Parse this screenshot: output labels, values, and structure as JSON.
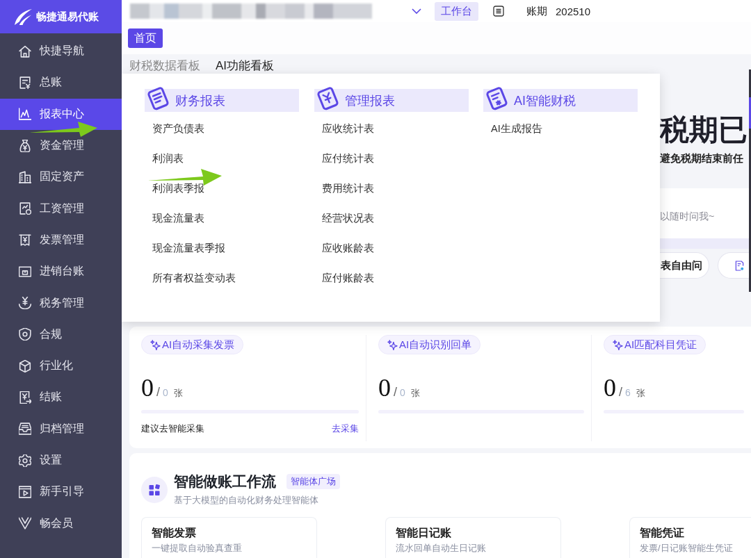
{
  "sidebar": {
    "brand": "畅捷通易代账",
    "items": [
      {
        "label": "快捷导航",
        "selected": false
      },
      {
        "label": "总账",
        "selected": false
      },
      {
        "label": "报表中心",
        "selected": true
      },
      {
        "label": "资金管理",
        "selected": false
      },
      {
        "label": "固定资产",
        "selected": false
      },
      {
        "label": "工资管理",
        "selected": false
      },
      {
        "label": "发票管理",
        "selected": false
      },
      {
        "label": "进销台账",
        "selected": false
      },
      {
        "label": "税务管理",
        "selected": false
      },
      {
        "label": "合规",
        "selected": false
      },
      {
        "label": "行业化",
        "selected": false
      },
      {
        "label": "结账",
        "selected": false
      },
      {
        "label": "归档管理",
        "selected": false
      },
      {
        "label": "设置",
        "selected": false
      },
      {
        "label": "新手引导",
        "selected": false
      },
      {
        "label": "畅会员",
        "selected": false
      }
    ]
  },
  "top_bar": {
    "workbench": "工作台",
    "period_label": "账期",
    "period": "202510"
  },
  "page_tabs": [
    {
      "label": "首页",
      "selected": true
    }
  ],
  "board_tabs": [
    {
      "label": "财税数据看板",
      "selected": false
    },
    {
      "label": "AI功能看板",
      "selected": true
    }
  ],
  "report_menu": {
    "columns": [
      {
        "title": "财务报表",
        "items": [
          "资产负债表",
          "利润表",
          "利润表季报",
          "现金流量表",
          "现金流量表季报",
          "所有者权益变动表"
        ]
      },
      {
        "title": "管理报表",
        "items": [
          "应收统计表",
          "应付统计表",
          "费用统计表",
          "经营状况表",
          "应收账龄表",
          "应付账龄表"
        ]
      },
      {
        "title": "AI智能财税",
        "items": [
          "AI生成报告"
        ]
      }
    ]
  },
  "tax_banner": {
    "headline": "税期已",
    "subtitle": "避免税期结束前任",
    "placeholder": "以随时问我~",
    "chips": [
      "表自由问"
    ]
  },
  "ai_stats": [
    {
      "tag": "AI自动采集发票",
      "count": "0",
      "separator": "/",
      "total": "0",
      "unit": "张",
      "hint": "建议去智能采集",
      "action": "去采集"
    },
    {
      "tag": "AI自动识别回单",
      "count": "0",
      "separator": "/",
      "total": "0",
      "unit": "张"
    },
    {
      "tag": "AI匹配科目凭证",
      "count": "0",
      "separator": "/",
      "total": "6",
      "unit": "张"
    }
  ],
  "workflow": {
    "title": "智能做账工作流",
    "tag": "智能体广场",
    "subtitle": "基于大模型的自动化财务处理智能体",
    "agents": [
      {
        "title": "智能发票",
        "description": "一键提取自动验真查重"
      },
      {
        "title": "智能日记账",
        "description": "流水回单自动生日记账"
      },
      {
        "title": "智能凭证",
        "description": "发票/日记账智能生凭证"
      }
    ]
  }
}
